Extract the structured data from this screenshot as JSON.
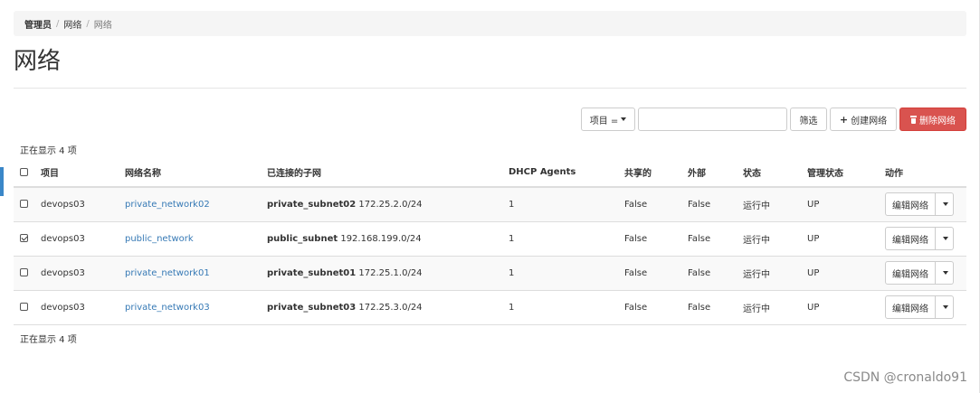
{
  "breadcrumb": [
    "管理员",
    "网络",
    "网络"
  ],
  "page_title": "网络",
  "toolbar": {
    "filter_field": "项目 =",
    "filter_value": "",
    "filter_button": "筛选",
    "create_button": "创建网络",
    "delete_button": "删除网络"
  },
  "count_text": "正在显示 4 项",
  "table": {
    "headers": {
      "project": "项目",
      "name": "网络名称",
      "subnets": "已连接的子网",
      "dhcp": "DHCP Agents",
      "shared": "共享的",
      "external": "外部",
      "status": "状态",
      "admin_state": "管理状态",
      "actions": "动作"
    },
    "rows": [
      {
        "checked": false,
        "project": "devops03",
        "name": "private_network02",
        "subnet_name": "private_subnet02",
        "subnet_cidr": "172.25.2.0/24",
        "dhcp": "1",
        "shared": "False",
        "external": "False",
        "status": "运行中",
        "admin_state": "UP",
        "action": "编辑网络"
      },
      {
        "checked": true,
        "project": "devops03",
        "name": "public_network",
        "subnet_name": "public_subnet",
        "subnet_cidr": "192.168.199.0/24",
        "dhcp": "1",
        "shared": "False",
        "external": "False",
        "status": "运行中",
        "admin_state": "UP",
        "action": "编辑网络"
      },
      {
        "checked": false,
        "project": "devops03",
        "name": "private_network01",
        "subnet_name": "private_subnet01",
        "subnet_cidr": "172.25.1.0/24",
        "dhcp": "1",
        "shared": "False",
        "external": "False",
        "status": "运行中",
        "admin_state": "UP",
        "action": "编辑网络"
      },
      {
        "checked": false,
        "project": "devops03",
        "name": "private_network03",
        "subnet_name": "private_subnet03",
        "subnet_cidr": "172.25.3.0/24",
        "dhcp": "1",
        "shared": "False",
        "external": "False",
        "status": "运行中",
        "admin_state": "UP",
        "action": "编辑网络"
      }
    ]
  },
  "watermark": "CSDN @cronaldo91",
  "colors": {
    "link": "#3679b5",
    "danger": "#d9534f",
    "accent": "#3a87c8"
  },
  "icons": {
    "create": "plus-icon",
    "delete": "trash-icon",
    "dropdown": "caret-down-icon"
  }
}
